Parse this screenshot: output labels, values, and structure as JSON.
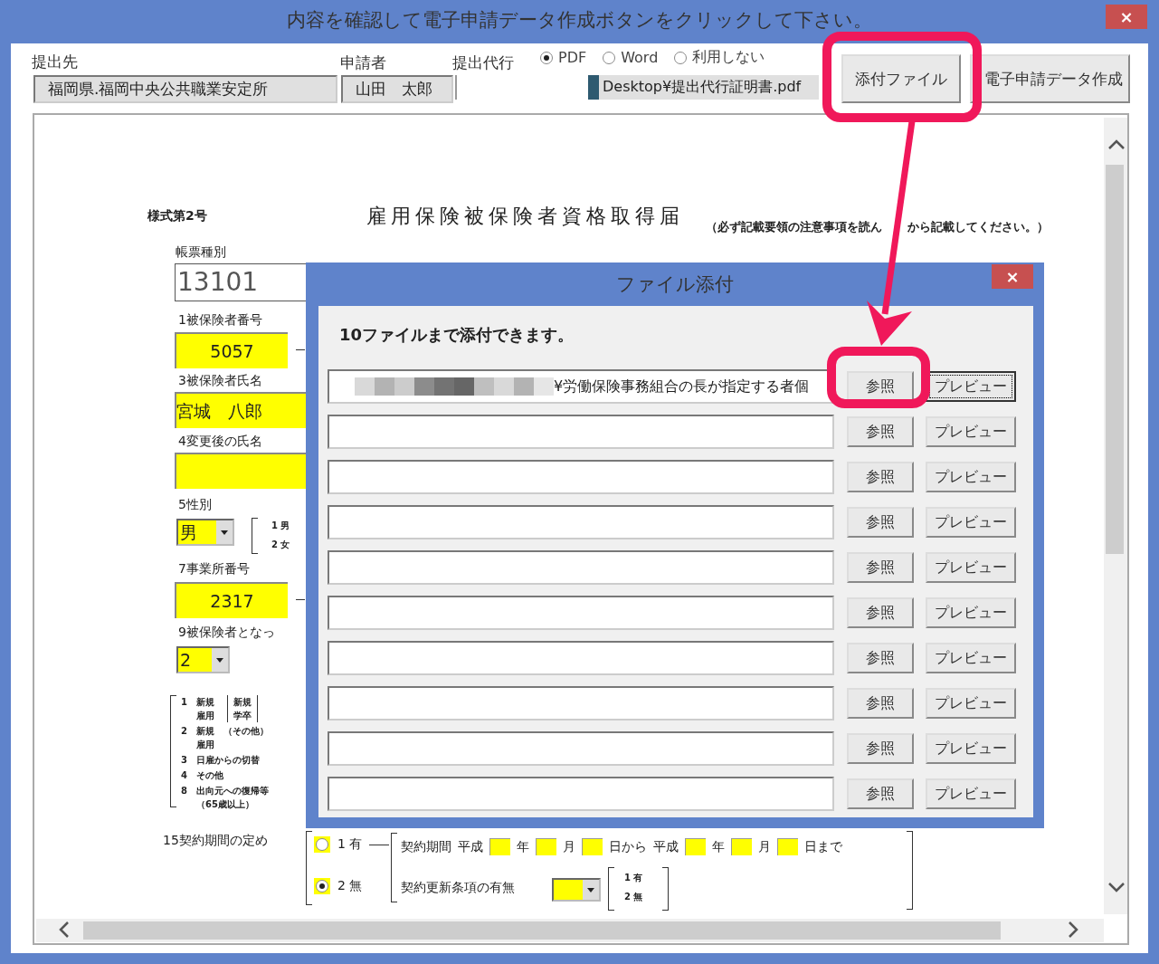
{
  "window": {
    "title": "内容を確認して電子申請データ作成ボタンをクリックして下さい。",
    "close": "×"
  },
  "header": {
    "submit_to": {
      "label": "提出先",
      "value": "福岡県.福岡中央公共職業安定所"
    },
    "applicant": {
      "label": "申請者",
      "value": "山田　太郎"
    },
    "proxy": {
      "label": "提出代行",
      "value": "Desktop¥提出代行証明書.pdf",
      "redacted": true
    },
    "format_options": [
      {
        "label": "PDF",
        "selected": true
      },
      {
        "label": "Word",
        "selected": false
      },
      {
        "label": "利用しない",
        "selected": false
      }
    ],
    "buttons": [
      {
        "label": "添付ファイル"
      },
      {
        "label": "電子申請データ作成"
      }
    ]
  },
  "form": {
    "form_no": "様式第2号",
    "title": "雇用保険被保険者資格取得届",
    "note": [
      "（必ず記載要領の注意事項を読ん",
      "から記載してください。）"
    ],
    "form_type": {
      "label": "帳票種別",
      "value": "13101"
    },
    "insured_number": {
      "label": "1被保険者番号",
      "value": "5057"
    },
    "insured_name": {
      "label": "3被保険者氏名",
      "value": "宮城　八郎"
    },
    "changed_name": {
      "label": "4変更後の氏名"
    },
    "sex": {
      "label": "5性別",
      "value": "男",
      "options": [
        "1 男",
        "2 女"
      ]
    },
    "office_number": {
      "label": "7事業所番号",
      "value": "2317"
    },
    "cause": {
      "label": "9被保険者となっ",
      "value": "2",
      "options": [
        {
          "num": "1",
          "lines": [
            "新規",
            "雇用"
          ],
          "note": [
            "新規",
            "学卒"
          ]
        },
        {
          "num": "2",
          "lines": [
            "新規　（その他）",
            "雇用"
          ]
        },
        {
          "num": "3",
          "lines": [
            "日雇からの切替"
          ]
        },
        {
          "num": "4",
          "lines": [
            "その他"
          ]
        },
        {
          "num": "8",
          "lines": [
            "出向元への復帰等",
            "（65歳以上）"
          ]
        }
      ]
    },
    "contract": {
      "label": "15契約期間の定め",
      "options": [
        {
          "label": "1 有",
          "selected": false
        },
        {
          "label": "2 無",
          "selected": true
        }
      ],
      "period_label": "契約期間",
      "period": [
        {
          "text": "平成",
          "box": true
        },
        {
          "text": "年",
          "box": true
        },
        {
          "text": "月",
          "box": true
        },
        {
          "text": "日から",
          "box": false
        },
        {
          "text": "平成",
          "box": true
        },
        {
          "text": "年",
          "box": true
        },
        {
          "text": "月",
          "box": true
        },
        {
          "text": "日まで",
          "box": false
        }
      ],
      "renewal_label": "契約更新条項の有無",
      "renewal_options": [
        "1 有",
        "2 無"
      ]
    }
  },
  "dialog": {
    "title": "ファイル添付",
    "close": "×",
    "message": "10ファイルまで添付できます。",
    "rows": [
      {
        "path": "¥労働保険事務組合の長が指定する者個",
        "redacted": true,
        "browse": "参照",
        "preview": "プレビュー"
      },
      {
        "browse": "参照",
        "preview": "プレビュー"
      },
      {
        "browse": "参照",
        "preview": "プレビュー"
      },
      {
        "browse": "参照",
        "preview": "プレビュー"
      },
      {
        "browse": "参照",
        "preview": "プレビュー"
      },
      {
        "browse": "参照",
        "preview": "プレビュー"
      },
      {
        "browse": "参照",
        "preview": "プレビュー"
      },
      {
        "browse": "参照",
        "preview": "プレビュー"
      },
      {
        "browse": "参照",
        "preview": "プレビュー"
      },
      {
        "browse": "参照",
        "preview": "プレビュー"
      }
    ]
  }
}
